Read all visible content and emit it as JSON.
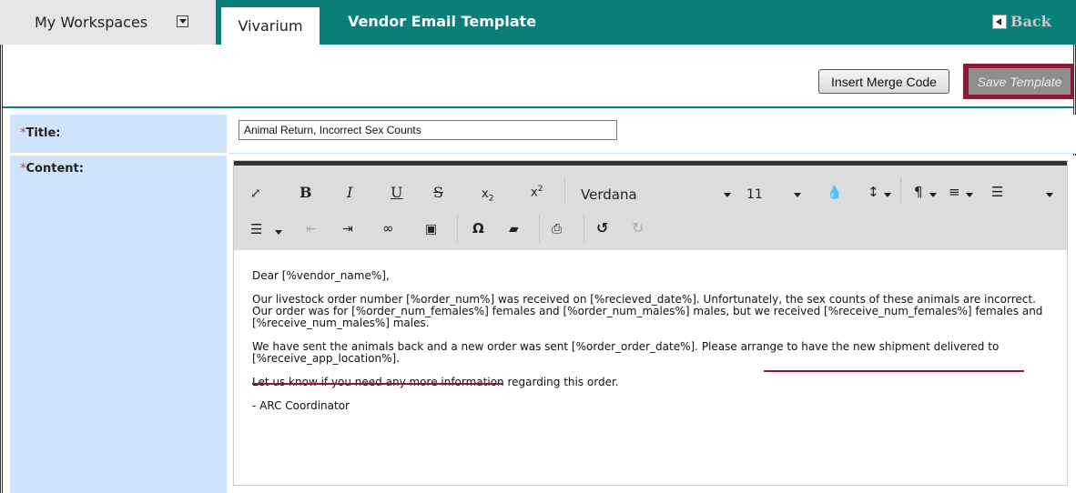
{
  "topbar": {
    "workspaces_label": "My Workspaces",
    "active_tab": "Vivarium",
    "page_title": "Vendor Email Template",
    "back_label": "Back"
  },
  "actions": {
    "insert_merge_code": "Insert Merge Code",
    "save_template": "Save Template"
  },
  "form": {
    "title_label": "Title:",
    "content_label": "Content:",
    "required_mark": "*",
    "title_value": "Animal Return, Incorrect Sex Counts"
  },
  "editor": {
    "font_name": "Verdana",
    "font_size": "11",
    "toolbar_row1": [
      "fullscreen-icon",
      "bold-icon",
      "italic-icon",
      "underline-icon",
      "strikethrough-icon",
      "subscript-icon",
      "superscript-icon",
      "font-family-select",
      "font-size-select",
      "text-color-icon",
      "line-height-icon",
      "paragraph-format-icon",
      "align-icon",
      "ordered-list-icon"
    ],
    "toolbar_row2": [
      "unordered-list-icon",
      "outdent-icon",
      "indent-icon",
      "link-icon",
      "image-icon",
      "special-char-icon",
      "clear-format-icon",
      "print-icon",
      "undo-icon",
      "redo-icon"
    ],
    "body": {
      "greeting": "Dear [%vendor_name%],",
      "para1": "Our livestock order number [%order_num%] was received on [%recieved_date%]. Unfortunately, the sex counts of these animals are incorrect. Our order was for [%order_num_females%] females and [%order_num_males%] males, but we received [%receive_num_females%] females and [%receive_num_males%] males.",
      "para2a": "We have sent the animals back and a new order was sent [%order_order_date%].",
      "para2b": "Please arrange to have the new shipment delivered to [%receive_app_location%].",
      "para3": "Let us know if you need any more information regarding this order.",
      "signature": "- ARC Coordinator"
    }
  },
  "colors": {
    "teal": "#0a7f7a",
    "label_bg": "#cfe3fb",
    "accent_maroon": "#8a1c3a"
  }
}
